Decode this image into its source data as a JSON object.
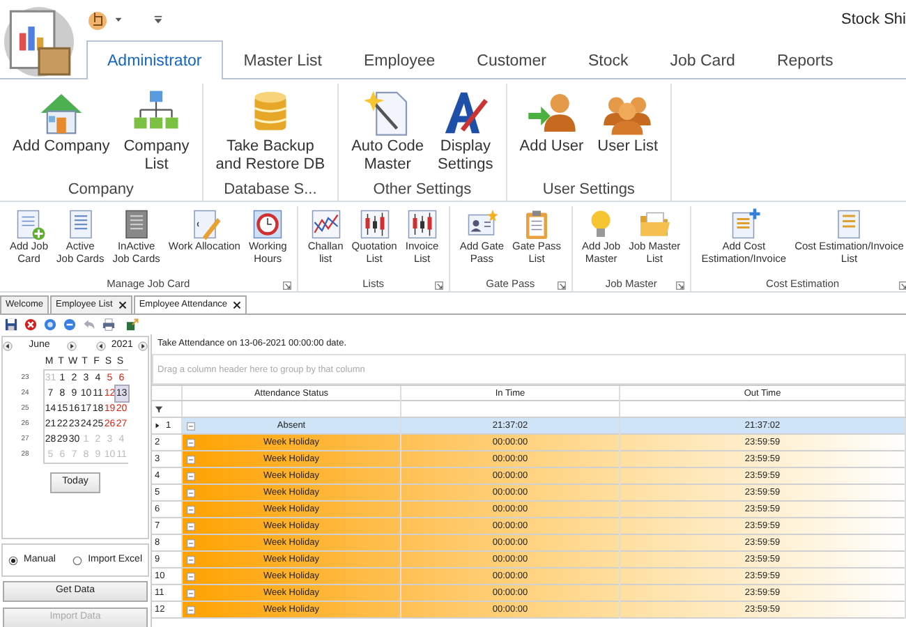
{
  "window": {
    "title": "Stock Shi"
  },
  "ribbon_tabs": [
    {
      "label": "Administrator",
      "selected": true
    },
    {
      "label": "Master List",
      "selected": false
    },
    {
      "label": "Employee",
      "selected": false
    },
    {
      "label": "Customer",
      "selected": false
    },
    {
      "label": "Stock",
      "selected": false
    },
    {
      "label": "Job Card",
      "selected": false
    },
    {
      "label": "Reports",
      "selected": false
    }
  ],
  "ribbon_groups": [
    {
      "label": "Company",
      "buttons": [
        "Add Company",
        "Company\nList"
      ]
    },
    {
      "label": "Database S...",
      "buttons": [
        "Take Backup\nand Restore DB"
      ]
    },
    {
      "label": "Other Settings",
      "buttons": [
        "Auto Code\nMaster",
        "Display\nSettings"
      ]
    },
    {
      "label": "User Settings",
      "buttons": [
        "Add User",
        "User List"
      ]
    }
  ],
  "toolbar_groups": [
    {
      "label": "Manage Job Card",
      "launcher": true,
      "buttons": [
        "Add Job\nCard",
        "Active\nJob Cards",
        "InActive\nJob Cards",
        "Work Allocation",
        "Working\nHours"
      ]
    },
    {
      "label": "Lists",
      "launcher": true,
      "buttons": [
        "Challan\nlist",
        "Quotation\nList",
        "Invoice\nList"
      ]
    },
    {
      "label": "Gate Pass",
      "launcher": true,
      "buttons": [
        "Add Gate\nPass",
        "Gate Pass\nList"
      ]
    },
    {
      "label": "Job Master",
      "launcher": true,
      "buttons": [
        "Add Job\nMaster",
        "Job Master\nList"
      ]
    },
    {
      "label": "Cost Estimation",
      "launcher": true,
      "buttons": [
        "Add Cost\nEstimation/Invoice",
        "Cost Estimation/Invoice\nList"
      ]
    }
  ],
  "document_tabs": [
    {
      "label": "Welcome",
      "selected": false,
      "closable": false
    },
    {
      "label": "Employee List",
      "selected": false,
      "closable": true
    },
    {
      "label": "Employee Attendance",
      "selected": true,
      "closable": true
    }
  ],
  "calendar": {
    "month": "June",
    "year": "2021",
    "weekdays": [
      "M",
      "T",
      "W",
      "T",
      "F",
      "S",
      "S"
    ],
    "weeks": [
      {
        "number": "23",
        "days": [
          {
            "day": "31",
            "kind": "other",
            "selected": false
          },
          {
            "day": "1",
            "kind": "normal",
            "selected": false
          },
          {
            "day": "2",
            "kind": "normal",
            "selected": false
          },
          {
            "day": "3",
            "kind": "normal",
            "selected": false
          },
          {
            "day": "4",
            "kind": "normal",
            "selected": false
          },
          {
            "day": "5",
            "kind": "weekend",
            "selected": false
          },
          {
            "day": "6",
            "kind": "weekend",
            "selected": false
          }
        ]
      },
      {
        "number": "24",
        "days": [
          {
            "day": "7",
            "kind": "normal",
            "selected": false
          },
          {
            "day": "8",
            "kind": "normal",
            "selected": false
          },
          {
            "day": "9",
            "kind": "normal",
            "selected": false
          },
          {
            "day": "10",
            "kind": "normal",
            "selected": false
          },
          {
            "day": "11",
            "kind": "normal",
            "selected": false
          },
          {
            "day": "12",
            "kind": "weekend",
            "selected": false
          },
          {
            "day": "13",
            "kind": "normal",
            "selected": true
          }
        ]
      },
      {
        "number": "25",
        "days": [
          {
            "day": "14",
            "kind": "normal",
            "selected": false
          },
          {
            "day": "15",
            "kind": "normal",
            "selected": false
          },
          {
            "day": "16",
            "kind": "normal",
            "selected": false
          },
          {
            "day": "17",
            "kind": "normal",
            "selected": false
          },
          {
            "day": "18",
            "kind": "normal",
            "selected": false
          },
          {
            "day": "19",
            "kind": "weekend",
            "selected": false
          },
          {
            "day": "20",
            "kind": "weekend",
            "selected": false
          }
        ]
      },
      {
        "number": "26",
        "days": [
          {
            "day": "21",
            "kind": "normal",
            "selected": false
          },
          {
            "day": "22",
            "kind": "normal",
            "selected": false
          },
          {
            "day": "23",
            "kind": "normal",
            "selected": false
          },
          {
            "day": "24",
            "kind": "normal",
            "selected": false
          },
          {
            "day": "25",
            "kind": "normal",
            "selected": false
          },
          {
            "day": "26",
            "kind": "weekend",
            "selected": false
          },
          {
            "day": "27",
            "kind": "weekend",
            "selected": false
          }
        ]
      },
      {
        "number": "27",
        "days": [
          {
            "day": "28",
            "kind": "normal",
            "selected": false
          },
          {
            "day": "29",
            "kind": "normal",
            "selected": false
          },
          {
            "day": "30",
            "kind": "normal",
            "selected": false
          },
          {
            "day": "1",
            "kind": "other",
            "selected": false
          },
          {
            "day": "2",
            "kind": "other",
            "selected": false
          },
          {
            "day": "3",
            "kind": "other",
            "selected": false
          },
          {
            "day": "4",
            "kind": "other",
            "selected": false
          }
        ]
      },
      {
        "number": "28",
        "days": [
          {
            "day": "5",
            "kind": "other",
            "selected": false
          },
          {
            "day": "6",
            "kind": "other",
            "selected": false
          },
          {
            "day": "7",
            "kind": "other",
            "selected": false
          },
          {
            "day": "8",
            "kind": "other",
            "selected": false
          },
          {
            "day": "9",
            "kind": "other",
            "selected": false
          },
          {
            "day": "10",
            "kind": "other",
            "selected": false
          },
          {
            "day": "11",
            "kind": "other",
            "selected": false
          }
        ]
      }
    ],
    "today_button": "Today"
  },
  "import_mode": [
    {
      "label": "Manual",
      "selected": true
    },
    {
      "label": "Import Excel",
      "selected": false
    }
  ],
  "actions": [
    {
      "label": "Get Data",
      "disabled": false
    },
    {
      "label": "Import Data",
      "disabled": true
    }
  ],
  "grid": {
    "caption": "Take Attendance on 13-06-2021 00:00:00 date.",
    "group_hint": "Drag a column header here to group by that column",
    "columns": [
      "Attendance Status",
      "In Time",
      "Out Time"
    ],
    "rows": [
      {
        "number": "1",
        "status": "Absent",
        "in_time": "21:37:02",
        "out_time": "21:37:02",
        "selected": true
      },
      {
        "number": "2",
        "status": "Week Holiday",
        "in_time": "00:00:00",
        "out_time": "23:59:59",
        "selected": false
      },
      {
        "number": "3",
        "status": "Week Holiday",
        "in_time": "00:00:00",
        "out_time": "23:59:59",
        "selected": false
      },
      {
        "number": "4",
        "status": "Week Holiday",
        "in_time": "00:00:00",
        "out_time": "23:59:59",
        "selected": false
      },
      {
        "number": "5",
        "status": "Week Holiday",
        "in_time": "00:00:00",
        "out_time": "23:59:59",
        "selected": false
      },
      {
        "number": "6",
        "status": "Week Holiday",
        "in_time": "00:00:00",
        "out_time": "23:59:59",
        "selected": false
      },
      {
        "number": "7",
        "status": "Week Holiday",
        "in_time": "00:00:00",
        "out_time": "23:59:59",
        "selected": false
      },
      {
        "number": "8",
        "status": "Week Holiday",
        "in_time": "00:00:00",
        "out_time": "23:59:59",
        "selected": false
      },
      {
        "number": "9",
        "status": "Week Holiday",
        "in_time": "00:00:00",
        "out_time": "23:59:59",
        "selected": false
      },
      {
        "number": "10",
        "status": "Week Holiday",
        "in_time": "00:00:00",
        "out_time": "23:59:59",
        "selected": false
      },
      {
        "number": "11",
        "status": "Week Holiday",
        "in_time": "00:00:00",
        "out_time": "23:59:59",
        "selected": false
      },
      {
        "number": "12",
        "status": "Week Holiday",
        "in_time": "00:00:00",
        "out_time": "23:59:59",
        "selected": false
      }
    ]
  }
}
